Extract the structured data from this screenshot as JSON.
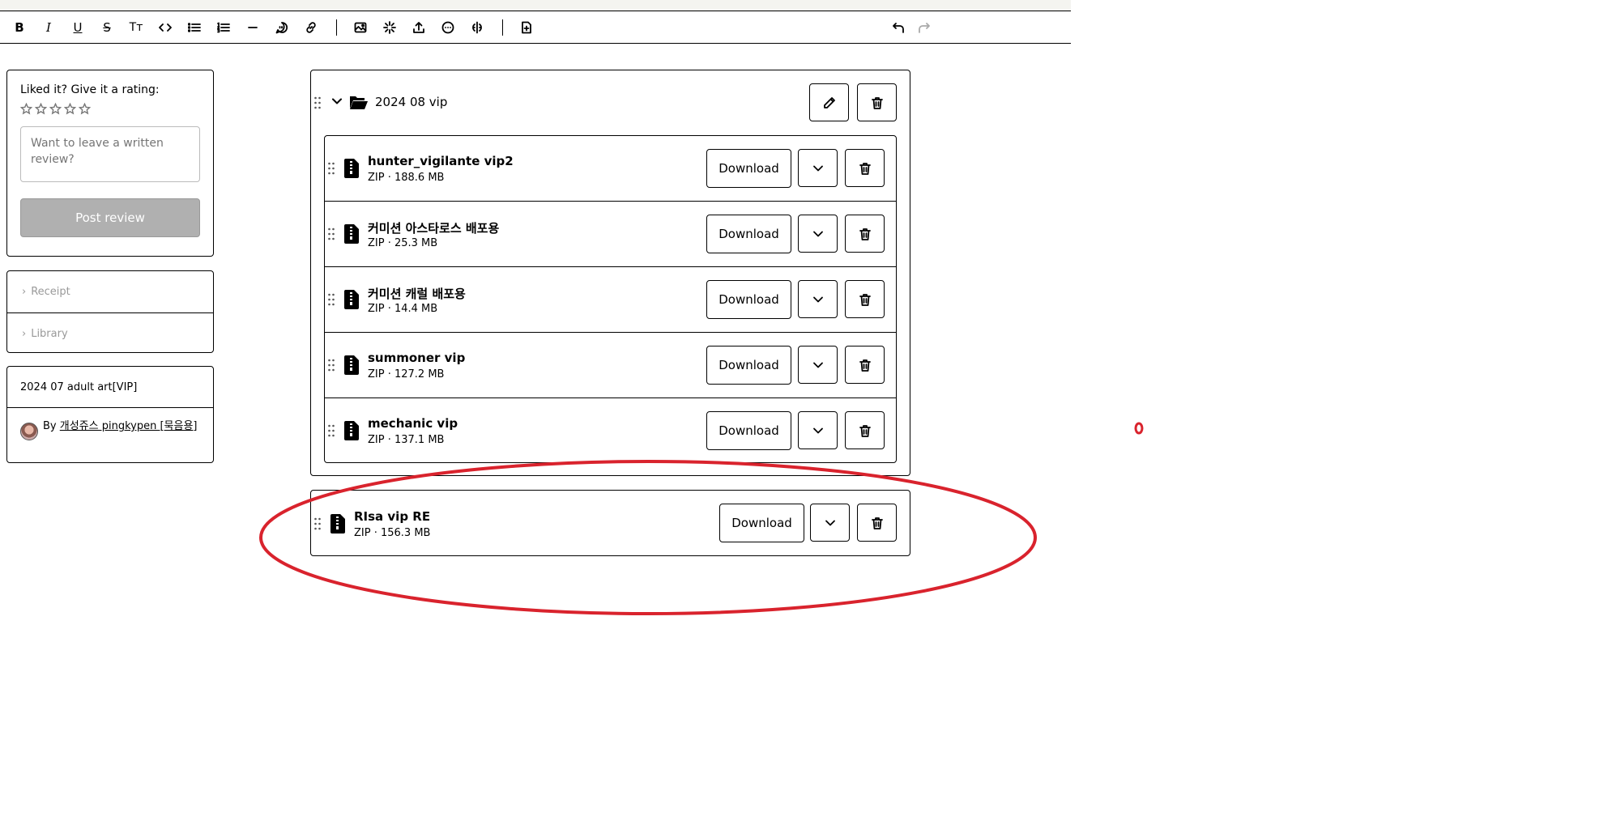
{
  "toolbar": {
    "bold_label": "B",
    "italic_label": "I",
    "underline_label": "U",
    "strike_label": "S",
    "textsize_label": "Tт"
  },
  "rating": {
    "label": "Liked it? Give it a rating:",
    "stars": 5,
    "review_placeholder": "Want to leave a written review?",
    "post_label": "Post review"
  },
  "accordion": {
    "items": [
      {
        "label": "Receipt"
      },
      {
        "label": "Library"
      }
    ]
  },
  "product": {
    "title": "2024 07 adult art[VIP]",
    "by_prefix": "By",
    "author": "개성쥬스 pingkypen [묵음용]"
  },
  "folder": {
    "name": "2024 08 vip",
    "files": [
      {
        "name": "hunter_vigilante vip2",
        "meta": "ZIP · 188.6 MB",
        "download_label": "Download"
      },
      {
        "name": "커미션 아스타로스 배포용",
        "meta": "ZIP · 25.3 MB",
        "download_label": "Download"
      },
      {
        "name": "커미션 캐럴 배포용",
        "meta": "ZIP · 14.4 MB",
        "download_label": "Download"
      },
      {
        "name": "summoner vip",
        "meta": "ZIP · 127.2 MB",
        "download_label": "Download"
      },
      {
        "name": "mechanic vip",
        "meta": "ZIP · 137.1 MB",
        "download_label": "Download"
      }
    ]
  },
  "single_file": {
    "name": "RIsa vip RE",
    "meta": "ZIP · 156.3 MB",
    "download_label": "Download"
  },
  "annotation": {
    "mark": "0",
    "color": "#d9232d"
  }
}
